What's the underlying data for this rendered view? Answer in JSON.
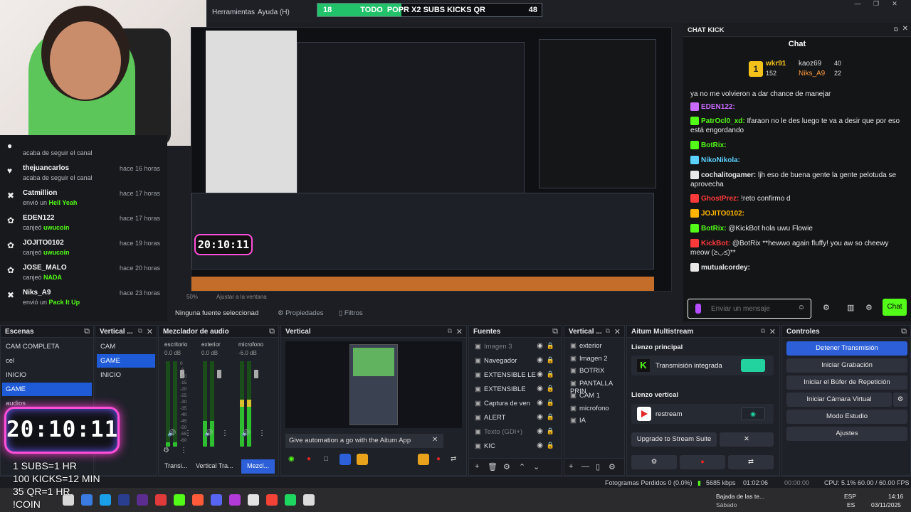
{
  "app": {
    "menus": [
      "Herramientas",
      "Ayuda (H)"
    ],
    "goal": {
      "left": "18",
      "label": "TODO",
      "title": "POPR X2 SUBS KICKS QR",
      "right": "48",
      "progress": 0.375
    }
  },
  "feed": [
    {
      "name": "",
      "action": "acaba de seguir el canal",
      "highlight": "",
      "time": "",
      "icon": "user-icon"
    },
    {
      "name": "thejuancarlos",
      "action": "acaba de seguir el canal",
      "highlight": "",
      "time": "hace 16 horas",
      "icon": "heart-icon"
    },
    {
      "name": "Catmillion",
      "action": "envió un",
      "highlight": "Hell Yeah",
      "time": "hace 17 horas",
      "icon": "kick-icon"
    },
    {
      "name": "EDEN122",
      "action": "canjeó",
      "highlight": "uwucoin",
      "time": "hace 17 horas",
      "icon": "gift-icon"
    },
    {
      "name": "JOJITO0102",
      "action": "canjeó",
      "highlight": "uwucoin",
      "time": "hace 19 horas",
      "icon": "gift-icon"
    },
    {
      "name": "JOSE_MALO",
      "action": "canjeó",
      "highlight": "NADA",
      "time": "hace 20 horas",
      "icon": "gift-icon"
    },
    {
      "name": "Niks_A9",
      "action": "envió un",
      "highlight": "Pack It Up",
      "time": "hace 23 horas",
      "icon": "kick-icon"
    }
  ],
  "chat": {
    "dock_title": "CHAT KICK",
    "title": "Chat",
    "leaders": [
      {
        "name": "wkr91",
        "value": "152"
      },
      {
        "name": "kaoz69",
        "value": "40"
      },
      {
        "name": "Niks_A9",
        "value": "22"
      }
    ],
    "messages": [
      {
        "user": "",
        "text": "ya no me volvieron a dar chance de manejar",
        "color": "#e8e8e8"
      },
      {
        "user": "EDEN122:",
        "text": "",
        "color": "#c96bff"
      },
      {
        "user": "PatrOcl0_xd:",
        "text": "Ifaraon no le des luego te va a desir que por eso está engordando",
        "color": "#53fc18"
      },
      {
        "user": "BotRix:",
        "text": "",
        "color": "#53fc18"
      },
      {
        "user": "NikoNikola:",
        "text": "",
        "color": "#5ad1ff"
      },
      {
        "user": "cochalitogamer:",
        "text": "ljh eso de buena gente la gente pelotuda se aprovecha",
        "color": "#e8e8e8"
      },
      {
        "user": "GhostPrez:",
        "text": "!reto confirmo d",
        "color": "#ff3a3a"
      },
      {
        "user": "JOJITO0102:",
        "text": "",
        "color": "#ffb400"
      },
      {
        "user": "BotRix:",
        "text": "@KickBot hola uwu Flowie",
        "color": "#53fc18"
      },
      {
        "user": "KickBot:",
        "text": "@BotRix **hewwo again fluffy! you aw so cheewy meow (≥◡≤)**",
        "color": "#ff3a3a"
      },
      {
        "user": "mutualcordey:",
        "text": "",
        "color": "#e8e8e8"
      }
    ],
    "input_placeholder": "Enviar un mensaje",
    "send_label": "Chat"
  },
  "preview_bar": {
    "zoom": "50%",
    "fit": "Ajustar a la ventana"
  },
  "source_bar": {
    "selected": "Ninguna fuente seleccionad",
    "props": "Propiedades",
    "filters": "Filtros"
  },
  "docks": {
    "scenes": {
      "title": "Escenas",
      "items": [
        "CAM COMPLETA",
        "cel",
        "INICIO",
        "GAME",
        "audios"
      ],
      "selected": 3
    },
    "vertical_scenes": {
      "title": "Vertical ...",
      "items": [
        "CAM",
        "GAME",
        "INICIO"
      ],
      "selected": 1
    },
    "mixer": {
      "title": "Mezclador de audio",
      "channels": [
        {
          "name": "escritorio",
          "db": "0.0 dB",
          "level": 0.05
        },
        {
          "name": "exterior",
          "db": "0.0 dB",
          "level": 0.3
        },
        {
          "name": "microfono",
          "db": "-6.0 dB",
          "level": 0.55
        }
      ],
      "scale": [
        "0",
        "-5",
        "-10",
        "-15",
        "-20",
        "-25",
        "-30",
        "-35",
        "-40",
        "-45",
        "-50",
        "-55",
        "-60"
      ],
      "tabs": [
        "Transi...",
        "Vertical Tra...",
        "Mezcl..."
      ]
    },
    "vertical": {
      "title": "Vertical",
      "notice": "Give automation a go with the Aitum App"
    },
    "sources": {
      "title": "Fuentes",
      "items": [
        {
          "name": "Imagen 3",
          "dim": true
        },
        {
          "name": "Navegador",
          "dim": false
        },
        {
          "name": "EXTENSIBLE LE",
          "dim": false
        },
        {
          "name": "EXTENSIBLE",
          "dim": false
        },
        {
          "name": "Captura de ven",
          "dim": false
        },
        {
          "name": "ALERT",
          "dim": false
        },
        {
          "name": "Texto (GDI+)",
          "dim": true
        },
        {
          "name": "KIC",
          "dim": false
        }
      ]
    },
    "vertical_sources": {
      "title": "Vertical ...",
      "items": [
        "exterior",
        "Imagen 2",
        "BOTRIX",
        "PANTALLA PRIN",
        "CAM 1",
        "microfono",
        "IA"
      ]
    },
    "aitum": {
      "title": "Aitum Multistream",
      "main_label": "Lienzo principal",
      "main_service": "Transmisión integrada",
      "vertical_label": "Lienzo vertical",
      "vertical_service": "restream",
      "upgrade": "Upgrade to Stream Suite"
    },
    "controls": {
      "title": "Controles",
      "buttons": [
        "Detener Transmisión",
        "Iniciar Grabación",
        "Iniciar el Búfer de Repetición",
        "Iniciar Cámara Virtual",
        "Modo Estudio",
        "Ajustes"
      ]
    }
  },
  "overlay": {
    "timer": "20:10:11",
    "lines": [
      "1 SUBS=1 HR",
      "100 KICKS=12 MIN",
      "35 QR=1 HR",
      "!COIN"
    ]
  },
  "status": {
    "frames": "Fotogramas Perdidos 0 (0.0%)",
    "bitrate": "5685 kbps",
    "live_time": "01:02:06",
    "rec_time": "00:00:00",
    "cpu": "CPU: 5.1%",
    "fps": "60.00 / 60.00 FPS"
  },
  "taskbar": {
    "weather_title": "Bajada de las te...",
    "weather_sub": "Sábado",
    "lang1": "ESP",
    "lang2": "ES",
    "time": "14:16",
    "date": "03/11/2025"
  }
}
